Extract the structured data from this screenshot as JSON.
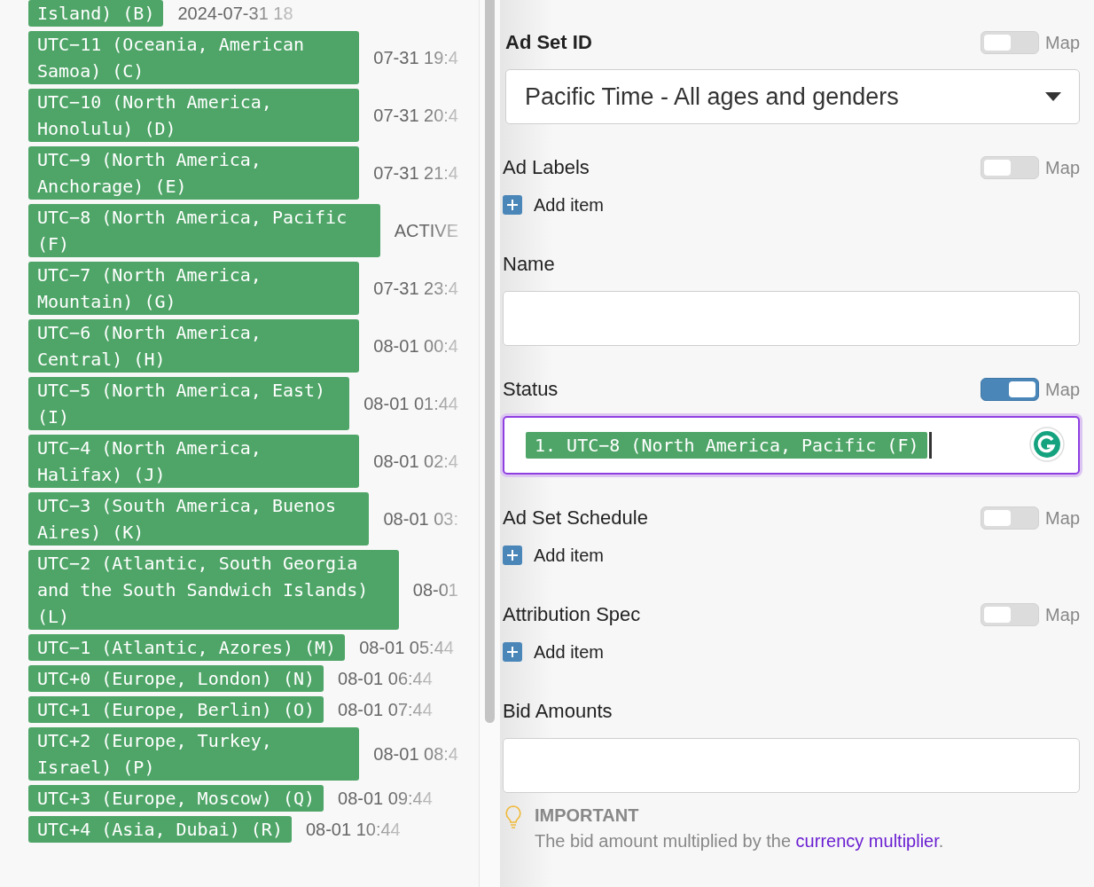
{
  "time_list": [
    {
      "zone": "Island) (B)",
      "time": "2024-07-31 18"
    },
    {
      "zone": "UTC−11 (Oceania, American Samoa) (C)",
      "time": "07-31 19:4"
    },
    {
      "zone": "UTC−10 (North America, Honolulu) (D)",
      "time": "07-31 20:4"
    },
    {
      "zone": "UTC−9 (North America, Anchorage) (E)",
      "time": "07-31 21:4"
    },
    {
      "zone": "UTC−8 (North America, Pacific (F)",
      "time": "ACTIVE"
    },
    {
      "zone": "UTC−7 (North America, Mountain) (G)",
      "time": "07-31 23:4"
    },
    {
      "zone": "UTC−6 (North America, Central) (H)",
      "time": "08-01 00:4"
    },
    {
      "zone": "UTC−5 (North America, East) (I)",
      "time": "08-01 01:44"
    },
    {
      "zone": "UTC−4 (North America, Halifax) (J)",
      "time": "08-01 02:4"
    },
    {
      "zone": "UTC−3 (South America, Buenos Aires) (K)",
      "time": "08-01 03:"
    },
    {
      "zone": "UTC−2 (Atlantic, South Georgia and the South Sandwich Islands) (L)",
      "time": "08-01"
    },
    {
      "zone": "UTC−1 (Atlantic, Azores) (M)",
      "time": "08-01 05:44"
    },
    {
      "zone": "UTC+0 (Europe, London) (N)",
      "time": "08-01 06:44"
    },
    {
      "zone": "UTC+1 (Europe, Berlin) (O)",
      "time": "08-01 07:44"
    },
    {
      "zone": "UTC+2 (Europe, Turkey, Israel) (P)",
      "time": "08-01 08:4"
    },
    {
      "zone": "UTC+3 (Europe, Moscow) (Q)",
      "time": "08-01 09:44"
    },
    {
      "zone": "UTC+4 (Asia, Dubai) (R)",
      "time": "08-01 10:44"
    }
  ],
  "form": {
    "fields": [
      {
        "kind": "select",
        "label": "Ad Set ID",
        "required": true,
        "map": false,
        "map_label": "Map",
        "value": "Pacific Time - All ages and genders"
      },
      {
        "kind": "list",
        "label": "Ad Labels",
        "required": false,
        "map": false,
        "map_label": "Map",
        "add_label": "Add item"
      },
      {
        "kind": "text",
        "label": "Name",
        "required": false
      },
      {
        "kind": "tags",
        "label": "Status",
        "required": false,
        "map": true,
        "map_label": "Map",
        "focused": true,
        "tags": [
          "1. UTC−8 (North America, Pacific (F)"
        ]
      },
      {
        "kind": "list",
        "label": "Ad Set Schedule",
        "required": false,
        "map": false,
        "map_label": "Map",
        "add_label": "Add item"
      },
      {
        "kind": "list",
        "label": "Attribution Spec",
        "required": false,
        "map": false,
        "map_label": "Map",
        "add_label": "Add item"
      },
      {
        "kind": "text",
        "label": "Bid Amounts",
        "required": false,
        "note": {
          "title": "IMPORTANT",
          "text": "The bid amount multiplied by the ",
          "link": "currency multiplier",
          "after": "."
        }
      }
    ]
  }
}
